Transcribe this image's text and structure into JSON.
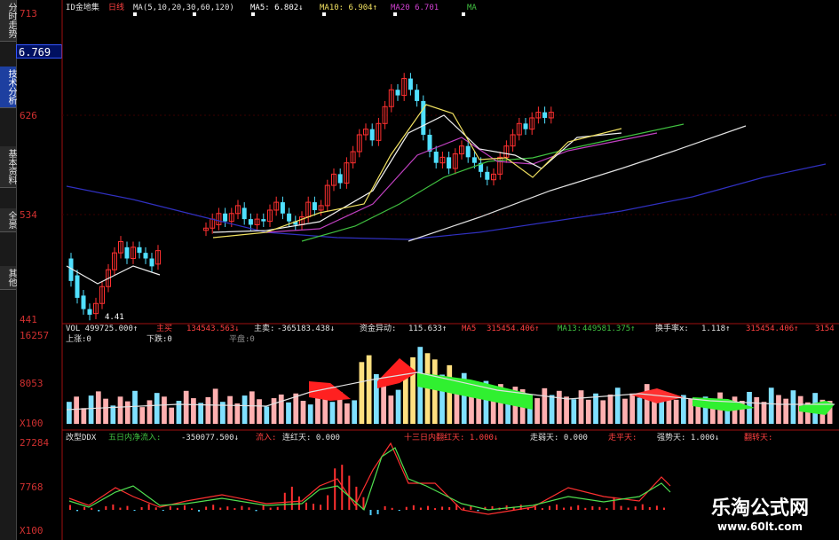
{
  "tabs": [
    {
      "label": "分时走势",
      "active": false
    },
    {
      "label": "技术分析",
      "active": true
    },
    {
      "label": "基本资料",
      "active": false
    },
    {
      "label": "全景",
      "active": false
    },
    {
      "label": "其他",
      "active": false
    }
  ],
  "current_price": "6.769",
  "price_header": {
    "name": "ID金地集",
    "period": "日线",
    "ma_set": "MA(5,10,20,30,60,120)",
    "ma5": "MA5: 6.802↓",
    "ma10": "MA10: 6.904↑",
    "ma20": "MA20 6.701",
    "ma_extra": "MA"
  },
  "vol_header": {
    "vol": "VOL 499725.000↑",
    "zhumai": "主买",
    "zhumai_val": "134543.563↓",
    "zhumai2": "主卖:",
    "zhumai2_val": "-365183.438↓",
    "zijin": "资金异动:",
    "zijin_val": "115.633↑",
    "ma5": "MA5",
    "ma5_val": "315454.406↑",
    "ma13": "MA13:",
    "ma13_val": "449581.375↑",
    "huanshou": "换手率x:",
    "huanshou_val": "1.118↑",
    "tail": "315454.406↑",
    "tail2": "3154",
    "shangzhang": "上涨:0",
    "xiadie": "下跌:0",
    "pingpan": "平盘:0"
  },
  "ddx_header": {
    "name": "改型DDX",
    "wuri": "五日内净流入:",
    "wuri_val": "-350077.500↓",
    "liuru": "流入:",
    "lianhong": "连红天: 0.000",
    "shisan": "十三日内翻红天: 1.000↓",
    "zoujiang": "走弱天: 0.000",
    "zhiping": "走平天:",
    "qiangshi": "强势天: 1.000↓",
    "fanzhuan": "翻转天:"
  },
  "y_labels": {
    "price": [
      "713",
      "626",
      "534",
      "441"
    ],
    "vol": [
      "16257",
      "8053",
      "X100"
    ],
    "ddx": [
      "27284",
      "7768",
      "X100"
    ]
  },
  "annotations": {
    "low_price": "4.41"
  },
  "watermark": {
    "title": "乐淘公式网",
    "url": "www.60lt.com"
  },
  "chart_data": [
    {
      "type": "candlestick",
      "title": "",
      "ylim": [
        4.41,
        7.13
      ],
      "y_ticks": [
        7.13,
        6.26,
        5.34,
        4.41
      ],
      "candles": [
        {
          "o": 4.95,
          "c": 4.75
        },
        {
          "o": 4.8,
          "c": 4.6
        },
        {
          "o": 4.62,
          "c": 4.5
        },
        {
          "o": 4.5,
          "c": 4.45
        },
        {
          "o": 4.46,
          "c": 4.55
        },
        {
          "o": 4.55,
          "c": 4.7
        },
        {
          "o": 4.7,
          "c": 4.85
        },
        {
          "o": 4.85,
          "c": 5.0
        },
        {
          "o": 5.0,
          "c": 5.1
        },
        {
          "o": 5.05,
          "c": 4.95
        },
        {
          "o": 4.95,
          "c": 5.05
        },
        {
          "o": 5.05,
          "c": 5.0
        },
        {
          "o": 5.0,
          "c": 4.95
        },
        {
          "o": 4.95,
          "c": 4.88
        },
        {
          "o": 4.9,
          "c": 5.02
        }
      ],
      "gap_note": "",
      "candles2": [
        {
          "o": 5.2,
          "c": 5.22
        },
        {
          "o": 5.22,
          "c": 5.3
        },
        {
          "o": 5.25,
          "c": 5.35
        },
        {
          "o": 5.35,
          "c": 5.28
        },
        {
          "o": 5.28,
          "c": 5.35
        },
        {
          "o": 5.35,
          "c": 5.42
        },
        {
          "o": 5.4,
          "c": 5.3
        },
        {
          "o": 5.3,
          "c": 5.25
        },
        {
          "o": 5.25,
          "c": 5.3
        },
        {
          "o": 5.3,
          "c": 5.28
        },
        {
          "o": 5.28,
          "c": 5.38
        },
        {
          "o": 5.38,
          "c": 5.45
        },
        {
          "o": 5.45,
          "c": 5.35
        },
        {
          "o": 5.35,
          "c": 5.28
        },
        {
          "o": 5.28,
          "c": 5.25
        },
        {
          "o": 5.25,
          "c": 5.32
        },
        {
          "o": 5.32,
          "c": 5.45
        },
        {
          "o": 5.45,
          "c": 5.38
        },
        {
          "o": 5.38,
          "c": 5.42
        },
        {
          "o": 5.42,
          "c": 5.6
        },
        {
          "o": 5.6,
          "c": 5.7
        },
        {
          "o": 5.7,
          "c": 5.62
        },
        {
          "o": 5.62,
          "c": 5.8
        },
        {
          "o": 5.8,
          "c": 5.9
        },
        {
          "o": 5.9,
          "c": 6.05
        },
        {
          "o": 6.05,
          "c": 6.1
        },
        {
          "o": 6.1,
          "c": 6.0
        },
        {
          "o": 6.0,
          "c": 6.15
        },
        {
          "o": 6.15,
          "c": 6.3
        },
        {
          "o": 6.3,
          "c": 6.45
        },
        {
          "o": 6.45,
          "c": 6.4
        },
        {
          "o": 6.4,
          "c": 6.55
        },
        {
          "o": 6.55,
          "c": 6.45
        },
        {
          "o": 6.45,
          "c": 6.35
        },
        {
          "o": 6.35,
          "c": 6.05
        },
        {
          "o": 6.05,
          "c": 5.9
        },
        {
          "o": 5.9,
          "c": 5.8
        },
        {
          "o": 5.8,
          "c": 5.85
        },
        {
          "o": 5.85,
          "c": 5.75
        },
        {
          "o": 5.75,
          "c": 5.88
        },
        {
          "o": 5.88,
          "c": 5.95
        },
        {
          "o": 5.95,
          "c": 5.85
        },
        {
          "o": 5.85,
          "c": 5.8
        },
        {
          "o": 5.8,
          "c": 5.72
        },
        {
          "o": 5.72,
          "c": 5.65
        },
        {
          "o": 5.65,
          "c": 5.7
        },
        {
          "o": 5.7,
          "c": 5.85
        },
        {
          "o": 5.85,
          "c": 5.95
        },
        {
          "o": 5.95,
          "c": 6.05
        },
        {
          "o": 6.05,
          "c": 6.15
        },
        {
          "o": 6.15,
          "c": 6.1
        },
        {
          "o": 6.1,
          "c": 6.2
        },
        {
          "o": 6.2,
          "c": 6.25
        },
        {
          "o": 6.25,
          "c": 6.2
        },
        {
          "o": 6.2,
          "c": 6.25
        }
      ]
    },
    {
      "type": "bar",
      "title": "",
      "ylim": [
        0,
        16257
      ],
      "values": [
        4200,
        5200,
        3000,
        5400,
        6200,
        4800,
        3500,
        5200,
        4300,
        6300,
        3200,
        4500,
        5900,
        5200,
        3100,
        4400,
        6300,
        4900,
        4000,
        5100,
        6700,
        4200,
        5300,
        3900,
        5400,
        6200,
        4700,
        3300,
        4900,
        5600,
        4100,
        5800,
        4400,
        3700,
        5500,
        5000,
        4200,
        6100,
        3900,
        4500,
        11800,
        13100,
        9500,
        8500,
        5400,
        6500,
        10600,
        12700,
        14700,
        13500,
        12300,
        9400,
        11200,
        8600,
        9700,
        6300,
        7400,
        8200,
        6500,
        7600,
        5900,
        7100,
        6600,
        5600,
        4900,
        6800,
        5500,
        6300,
        5200,
        4700,
        6400,
        4600,
        5800,
        4500,
        5600,
        6900,
        4800,
        5800,
        5000,
        7600,
        6200,
        4900,
        5800,
        4600,
        5500,
        4800,
        3900,
        5200,
        4300,
        6000,
        4600,
        5200,
        4400,
        6100,
        5100,
        4200,
        6900,
        5500,
        4800,
        6400,
        5300,
        4100,
        5900,
        4600,
        4400
      ]
    },
    {
      "type": "bar",
      "title": "",
      "ylim": [
        -3000,
        27284
      ],
      "values": [
        2000,
        -500,
        1200,
        800,
        -600,
        1500,
        2200,
        900,
        1600,
        -400,
        1100,
        2400,
        1000,
        -300,
        1500,
        800,
        1900,
        600,
        -700,
        1300,
        2100,
        900,
        1400,
        700,
        1600,
        1000,
        -500,
        1800,
        900,
        1200,
        7000,
        9500,
        5500,
        3000,
        2500,
        2100,
        6000,
        17000,
        18500,
        14000,
        9500,
        5200,
        -2200,
        -1800,
        1500,
        800,
        -400,
        1200,
        1900,
        900,
        1600,
        700,
        1300,
        1100,
        2400,
        900,
        1700,
        -500,
        1200,
        1500,
        900,
        1800,
        1300,
        2100,
        1000,
        1400,
        700,
        1600,
        2200,
        900,
        1300,
        1900,
        800,
        1500,
        1200,
        700,
        5200,
        1600,
        900,
        1400,
        2300,
        1100,
        1700,
        900
      ]
    }
  ]
}
